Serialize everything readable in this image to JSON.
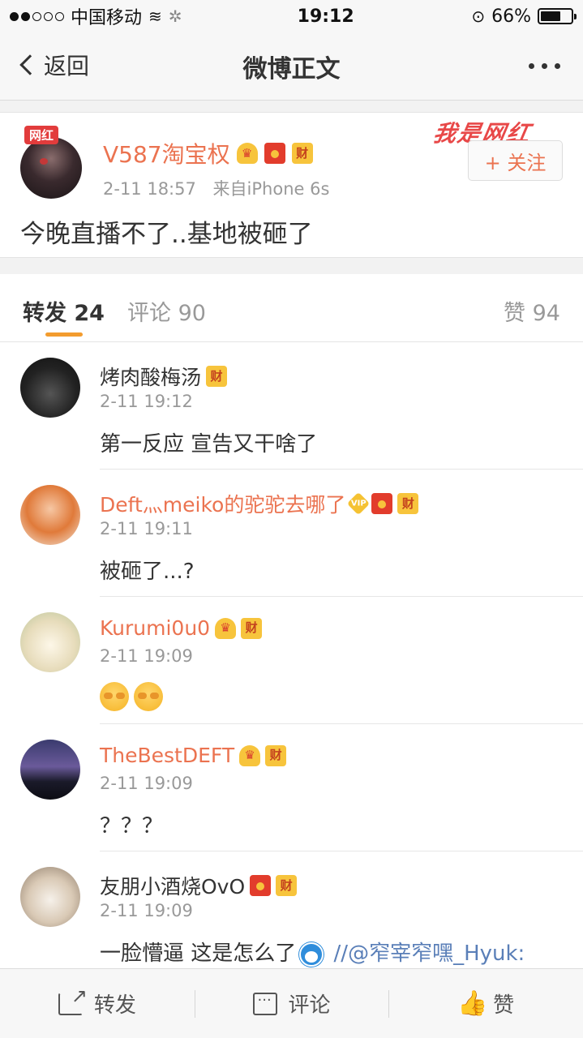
{
  "status_bar": {
    "carrier": "中国移动",
    "time": "19:12",
    "battery": "66%",
    "battery_level": 0.66
  },
  "nav": {
    "back_label": "返回",
    "title": "微博正文"
  },
  "post": {
    "badge": "网红",
    "author": "V587淘宝权",
    "time": "2-11 18:57",
    "source": "来自iPhone 6s",
    "text": "今晚直播不了..基地被砸了",
    "watermark": "我是网红",
    "follow_label": "+ 关注"
  },
  "tabs": {
    "repost": "转发 24",
    "comment": "评论 90",
    "like": "赞 94"
  },
  "badge_text": {
    "cai": "财",
    "vip": "VIP"
  },
  "comments": [
    {
      "name": "烤肉酸梅汤",
      "time": "2-11 19:12",
      "text": "第一反应 宣告又干啥了"
    },
    {
      "name": "Deft灬meiko的驼驼去哪了",
      "time": "2-11 19:11",
      "text": "被砸了...?"
    },
    {
      "name": "Kurumi0u0",
      "time": "2-11 19:09",
      "text": ""
    },
    {
      "name": "TheBestDEFT",
      "time": "2-11 19:09",
      "text": "？？？"
    },
    {
      "name": "友朋小酒烧OvO",
      "time": "2-11 19:09",
      "text": "一脸懵逼 这是怎么了",
      "text_tail": " //",
      "mention": "@窄宰窄嘿_Hyuk:"
    }
  ],
  "toolbar": {
    "repost": "转发",
    "comment": "评论",
    "like": "赞"
  },
  "colors": {
    "accent_orange": "#eb7350",
    "tab_underline": "#f39c2e",
    "mention_blue": "#5a7fb8"
  }
}
